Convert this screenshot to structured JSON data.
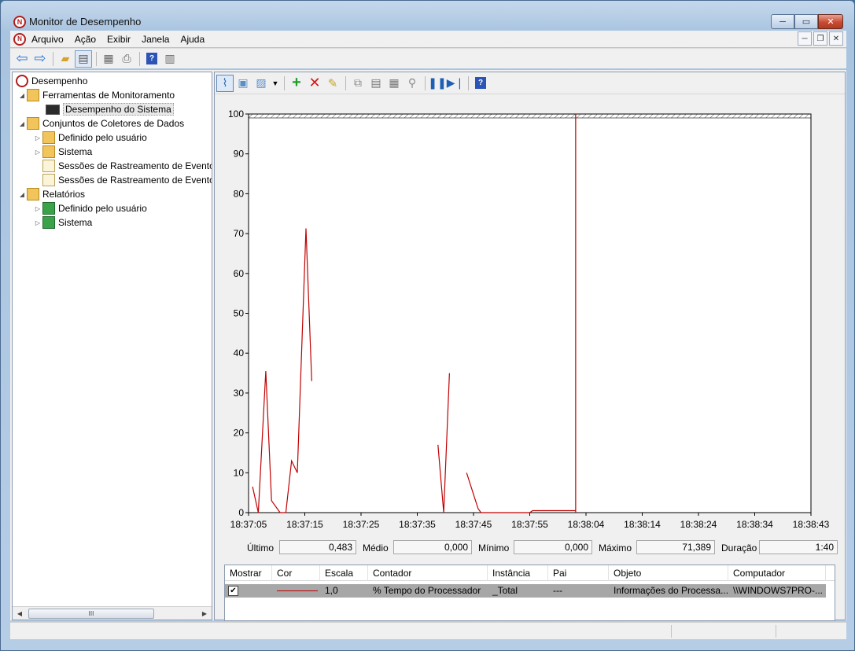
{
  "window": {
    "title": "Monitor de Desempenho",
    "icon": "perfmon-icon"
  },
  "caption": {
    "minimize": "─",
    "maximize": "▭",
    "close": "✕"
  },
  "mdi": {
    "minimize": "─",
    "restore": "❐",
    "close": "✕"
  },
  "menu": {
    "items": [
      "Arquivo",
      "Ação",
      "Exibir",
      "Janela",
      "Ajuda"
    ]
  },
  "toolbar1": {
    "help": "?"
  },
  "toolbar2": {
    "help": "?"
  },
  "tree": {
    "root": "Desempenho",
    "tools": "Ferramentas de Monitoramento",
    "system_performance": "Desempenho do Sistema",
    "collector_sets": "Conjuntos de Coletores de Dados",
    "user_defined": "Definido pelo usuário",
    "system": "Sistema",
    "trace_sessions_1": "Sessões de Rastreamento de Eventos",
    "trace_sessions_2": "Sessões de Rastreamento de Eventos",
    "reports": "Relatórios",
    "reports_user_defined": "Definido pelo usuário",
    "reports_system": "Sistema",
    "scroll_thumb": "III"
  },
  "stats": {
    "last_label": "Último",
    "last_value": "0,483",
    "avg_label": "Médio",
    "avg_value": "0,000",
    "min_label": "Mínimo",
    "min_value": "0,000",
    "max_label": "Máximo",
    "max_value": "71,389",
    "duration_label": "Duração",
    "duration_value": "1:40"
  },
  "legend": {
    "headers": [
      "Mostrar",
      "Cor",
      "Escala",
      "Contador",
      "Instância",
      "Pai",
      "Objeto",
      "Computador"
    ],
    "row": {
      "show": "✔",
      "scale": "1,0",
      "counter": "% Tempo do Processador",
      "instance": "_Total",
      "parent": "---",
      "object": "Informações do Processa...",
      "computer": "\\\\WINDOWS7PRO-..."
    }
  },
  "colors": {
    "series": "#c00000",
    "selection_bar": "#a7a7a7"
  },
  "chart_data": {
    "type": "line",
    "ylim": [
      0,
      100
    ],
    "yticks": [
      0,
      10,
      20,
      30,
      40,
      50,
      60,
      70,
      80,
      90,
      100
    ],
    "xticks": [
      "18:37:05",
      "18:37:15",
      "18:37:25",
      "18:37:35",
      "18:37:45",
      "18:37:55",
      "18:38:04",
      "18:38:14",
      "18:38:24",
      "18:38:34",
      "18:38:43"
    ],
    "x_range_seconds": [
      0,
      98
    ],
    "grid": false,
    "series": [
      {
        "segments": [
          [
            [
              0.7,
              6.5
            ],
            [
              1.7,
              0
            ],
            [
              3.0,
              35.5
            ],
            [
              4.0,
              3.0
            ],
            [
              5.5,
              0
            ],
            [
              6.5,
              0
            ],
            [
              7.5,
              13.0
            ],
            [
              8.5,
              10.0
            ],
            [
              10.0,
              71.3
            ],
            [
              11.0,
              33.0
            ]
          ],
          [
            [
              33.0,
              17.0
            ],
            [
              34.0,
              0
            ],
            [
              35.0,
              35.0
            ]
          ],
          [
            [
              38.0,
              10.0
            ],
            [
              40.0,
              1.0
            ],
            [
              40.5,
              0
            ],
            [
              49.0,
              0
            ],
            [
              49.5,
              0.5
            ],
            [
              57.0,
              0.5
            ]
          ]
        ],
        "cursor_seconds": 57.0,
        "cursor_value": 100
      }
    ]
  }
}
